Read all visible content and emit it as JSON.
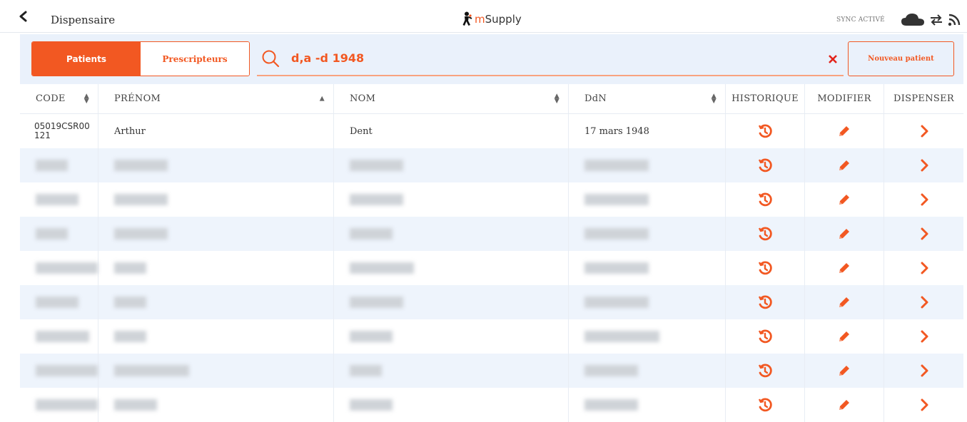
{
  "header": {
    "title": "Dispensaire",
    "logo_text_m": "m",
    "logo_text_rest": "Supply",
    "sync_status": "SYNC ACTIVÉ"
  },
  "tabs": [
    {
      "label": "Patients",
      "active": true
    },
    {
      "label": "Prescripteurs",
      "active": false
    }
  ],
  "search": {
    "value": "d,a -d 1948",
    "placeholder": ""
  },
  "new_patient_label": "Nouveau patient",
  "accent_color": "#f25822",
  "table": {
    "columns": [
      "CODE",
      "PRÉNOM",
      "NOM",
      "DdN",
      "HISTORIQUE",
      "MODIFIER",
      "DISPENSER"
    ],
    "rows": [
      {
        "code": "05019CSR00 121",
        "prenom": "Arthur",
        "nom": "Dent",
        "ddn": "17 mars 1948"
      },
      {
        "code": "",
        "prenom": "",
        "nom": "",
        "ddn": "",
        "obscured": true
      },
      {
        "code": "",
        "prenom": "",
        "nom": "",
        "ddn": "",
        "obscured": true
      },
      {
        "code": "",
        "prenom": "",
        "nom": "",
        "ddn": "",
        "obscured": true
      },
      {
        "code": "",
        "prenom": "",
        "nom": "",
        "ddn": "",
        "obscured": true
      },
      {
        "code": "",
        "prenom": "",
        "nom": "",
        "ddn": "",
        "obscured": true
      },
      {
        "code": "",
        "prenom": "",
        "nom": "",
        "ddn": "",
        "obscured": true
      },
      {
        "code": "",
        "prenom": "",
        "nom": "",
        "ddn": "",
        "obscured": true
      },
      {
        "code": "",
        "prenom": "",
        "nom": "",
        "ddn": "",
        "obscured": true
      }
    ],
    "row_icons": [
      "history-icon",
      "pencil-icon",
      "chevron-right-icon"
    ]
  }
}
